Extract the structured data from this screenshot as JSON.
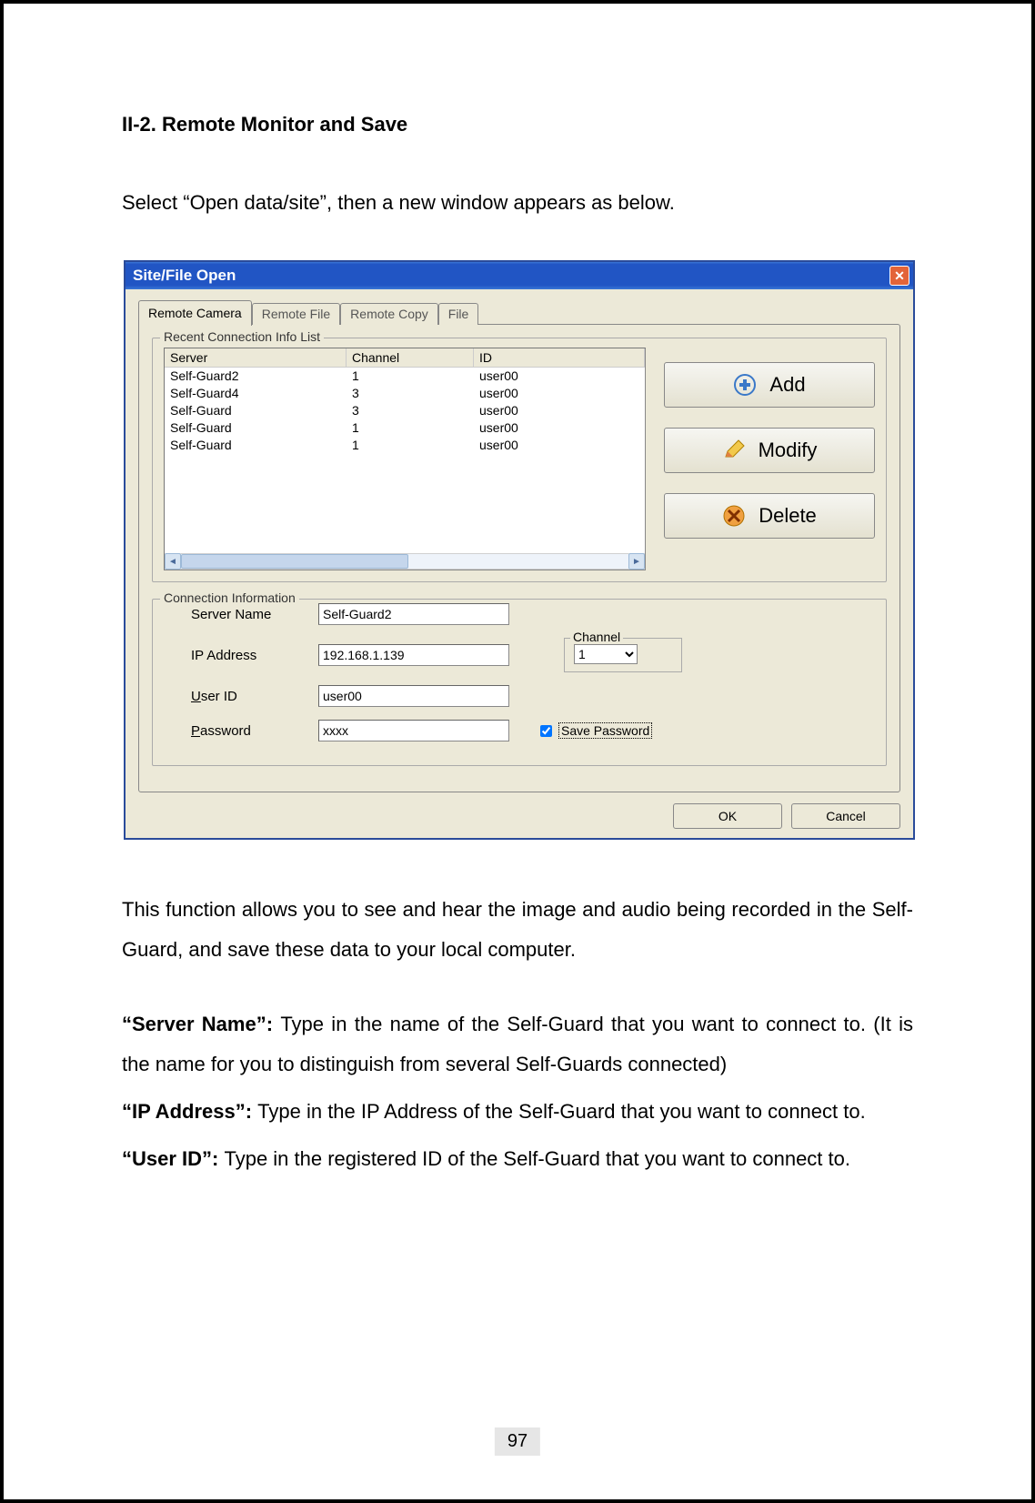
{
  "heading": "II-2. Remote Monitor and Save",
  "intro": "Select “Open data/site”, then a new window appears as below.",
  "dialog": {
    "title": "Site/File Open",
    "tabs": [
      "Remote Camera",
      "Remote File",
      "Remote Copy",
      "File"
    ],
    "recent_group": "Recent Connection Info List",
    "columns": {
      "server": "Server",
      "channel": "Channel",
      "id": "ID"
    },
    "rows": [
      {
        "server": "Self-Guard2",
        "channel": "1",
        "id": "user00"
      },
      {
        "server": "Self-Guard4",
        "channel": "3",
        "id": "user00"
      },
      {
        "server": "Self-Guard",
        "channel": "3",
        "id": "user00"
      },
      {
        "server": "Self-Guard",
        "channel": "1",
        "id": "user00"
      },
      {
        "server": "Self-Guard",
        "channel": "1",
        "id": "user00"
      }
    ],
    "buttons": {
      "add": "Add",
      "modify": "Modify",
      "delete": "Delete"
    },
    "conn_group": "Connection Information",
    "labels": {
      "server_name": "Server Name",
      "ip": "IP Address",
      "user": "User ID",
      "password": "Password",
      "channel": "Channel",
      "save_pw": "Save Password"
    },
    "values": {
      "server_name": "Self-Guard2",
      "ip": "192.168.1.139",
      "user": "user00",
      "password": "xxxx",
      "channel": "1",
      "save_pw_checked": true
    },
    "footer": {
      "ok": "OK",
      "cancel": "Cancel"
    }
  },
  "para1": "This function allows you to see and hear the image and audio being recorded in the Self-Guard, and save these data to your local computer.",
  "desc": {
    "server_name_label": "“Server Name”: ",
    "server_name_text": "Type in the name of the Self-Guard that you want to connect to. (It is the name for you to distinguish from several Self-Guards connected)",
    "ip_label": "“IP Address”: ",
    "ip_text": "Type in the IP Address of the Self-Guard that you want to connect to.",
    "user_label": "“User ID”: ",
    "user_text": "Type in the registered ID of the Self-Guard that you want to connect to."
  },
  "page_number": "97"
}
